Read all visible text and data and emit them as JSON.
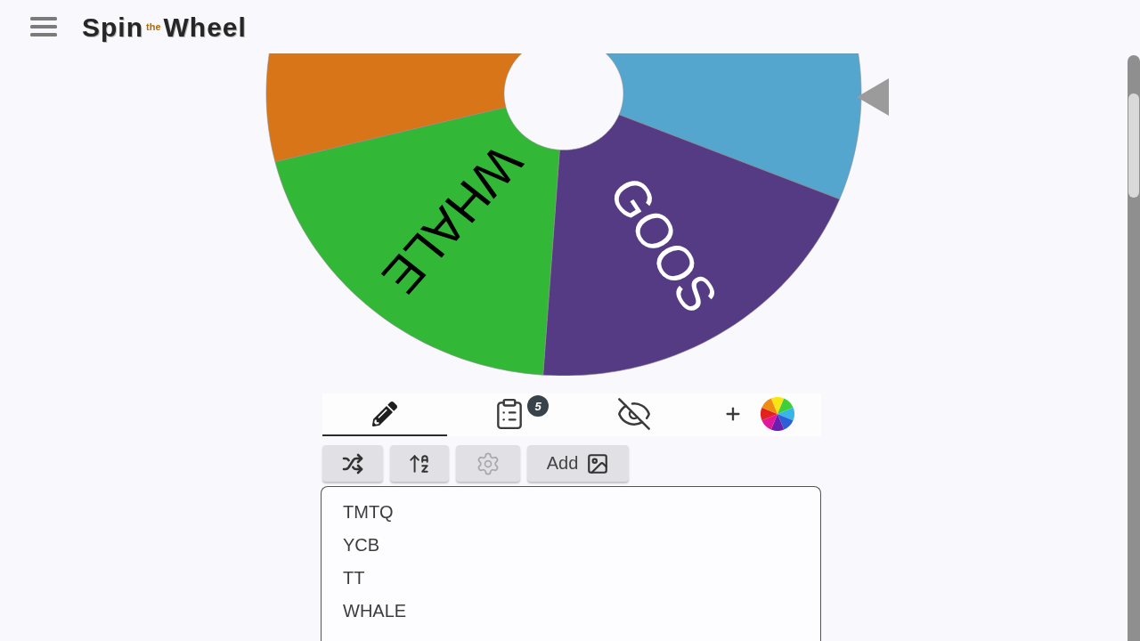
{
  "header": {
    "logo": [
      {
        "text": "Spin",
        "kind": "main"
      },
      {
        "text": "the",
        "kind": "small"
      },
      {
        "text": "Wheel",
        "kind": "main"
      }
    ]
  },
  "wheel": {
    "segments": [
      {
        "color": "#54a6cf"
      },
      {
        "label": "GOOS",
        "color": "#553a84"
      },
      {
        "label": "WHALE",
        "color": "#33b737"
      },
      {
        "color": "#d97519"
      }
    ]
  },
  "tabs": [
    {
      "kind": "edit",
      "selected": true
    },
    {
      "kind": "results",
      "selected": false,
      "badge": "5"
    },
    {
      "kind": "hidden",
      "selected": false
    },
    {
      "kind": "appearance",
      "selected": false
    }
  ],
  "toolbar": [
    {
      "kind": "shuffle",
      "disabled": false
    },
    {
      "kind": "sort",
      "disabled": false
    },
    {
      "kind": "settings",
      "disabled": true
    },
    {
      "kind": "add-image",
      "label": "Add",
      "disabled": false
    }
  ],
  "entries": [
    "TMTQ",
    "YCB",
    "TT",
    "WHALE"
  ]
}
